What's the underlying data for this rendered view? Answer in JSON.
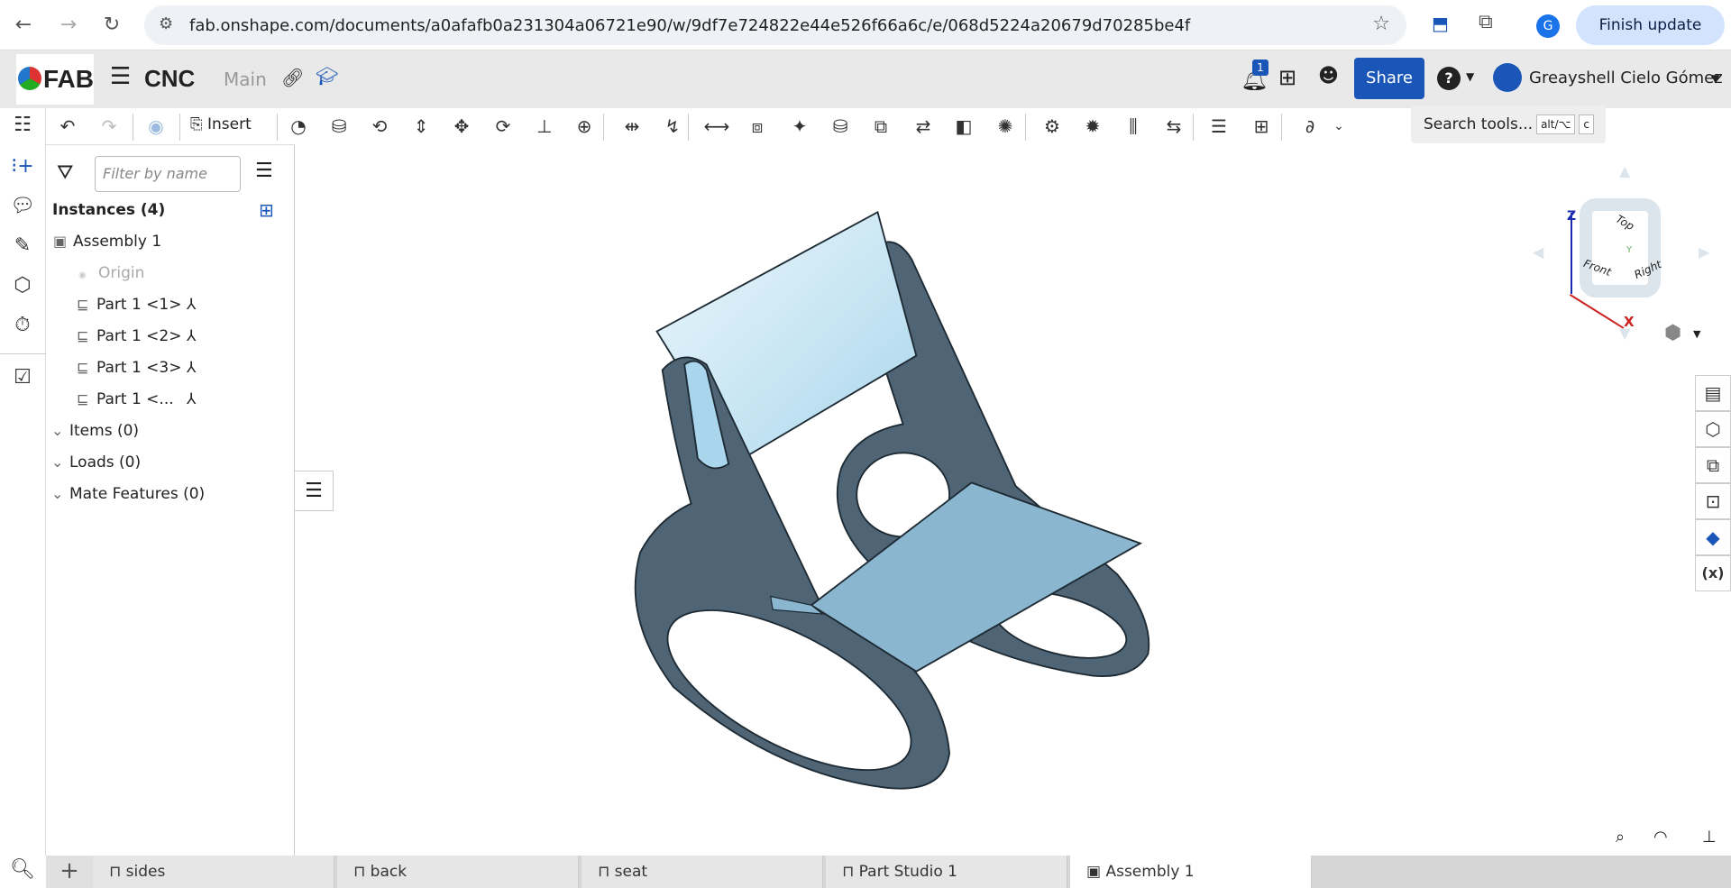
{
  "browser": {
    "url": "fab.onshape.com/documents/a0afafb0a231304a06721e90/w/9df7e724822e44e526f66a6c/e/068d5224a20679d70285be4f",
    "profile_initial": "G",
    "finish_update": "Finish update"
  },
  "header": {
    "logo": "FAB",
    "document_title": "CNC",
    "branch": "Main",
    "notification_count": "1",
    "share_label": "Share",
    "user_name": "Greayshell Cielo Gómez"
  },
  "toolbar": {
    "insert_label": "Insert",
    "search_placeholder": "Search tools...",
    "search_shortcut_1": "alt/⌥",
    "search_shortcut_2": "c",
    "tools": [
      "timeline-icon",
      "fastened-mate-icon",
      "revolute-mate-icon",
      "slider-mate-icon",
      "planar-mate-icon",
      "cylindrical-mate-icon",
      "pin-slot-mate-icon",
      "ball-mate-icon",
      "parallel-mate-icon",
      "tangent-mate-icon",
      "width-mate-icon",
      "group-icon",
      "replicate-icon",
      "mate-connector-icon",
      "linear-pattern-icon",
      "replace-icon",
      "section-view-icon",
      "explode-icon",
      "gear-relation-icon",
      "rack-pinion-icon",
      "screw-relation-icon",
      "linear-relation-icon",
      "bom-icon",
      "insert-part-icon",
      "sketch-tool-icon"
    ]
  },
  "panel": {
    "filter_placeholder": "Filter by name",
    "instances_header": "Instances (4)",
    "assembly": "Assembly 1",
    "origin": "Origin",
    "parts": [
      "Part 1 <1>",
      "Part 1 <2>",
      "Part 1 <3>",
      "Part 1 <..."
    ],
    "groups": [
      "Items (0)",
      "Loads (0)",
      "Mate Features (0)"
    ]
  },
  "viewcube": {
    "top": "Top",
    "front": "Front",
    "right": "Right",
    "axis_x": "X",
    "axis_y": "Y",
    "axis_z": "Z"
  },
  "tabs": [
    "sides",
    "back",
    "seat",
    "Part Studio 1",
    "Assembly 1"
  ],
  "active_tab": "Assembly 1",
  "colors": {
    "accent": "#1a56b8",
    "part_dark": "#4f6474",
    "seat": "#8bb6cf",
    "back": "#cde8f5"
  }
}
